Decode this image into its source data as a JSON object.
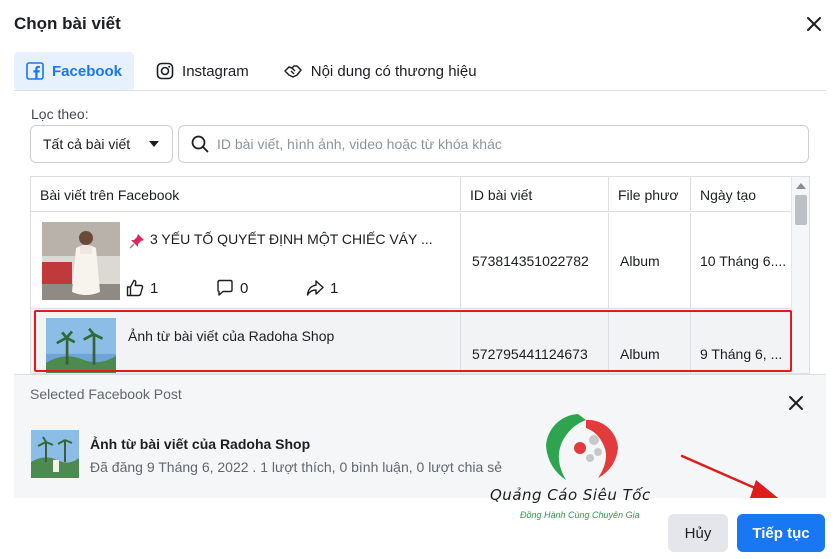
{
  "dialog": {
    "title": "Chọn bài viết"
  },
  "tabs": [
    {
      "label": "Facebook",
      "icon": "facebook-icon",
      "active": true
    },
    {
      "label": "Instagram",
      "icon": "instagram-icon",
      "active": false
    },
    {
      "label": "Nội dung có thương hiệu",
      "icon": "handshake-icon",
      "active": false
    }
  ],
  "filter": {
    "label": "Lọc theo:",
    "select_value": "Tất cả bài viết",
    "search_placeholder": "ID bài viết, hình ảnh, video hoặc từ khóa khác"
  },
  "table": {
    "headers": [
      "Bài viết trên Facebook",
      "ID bài viết",
      "File phươ",
      "Ngày tạo"
    ],
    "rows": [
      {
        "title": "3 YẾU TỐ QUYẾT ĐỊNH MỘT CHIẾC VÁY ...",
        "likes": "1",
        "comments": "0",
        "shares": "1",
        "post_id": "573814351022782",
        "type": "Album",
        "date": "10 Tháng 6...."
      },
      {
        "title": "Ảnh từ bài viết của Radoha Shop",
        "post_id": "572795441124673",
        "type": "Album",
        "date": "9 Tháng 6, ..."
      }
    ]
  },
  "selected": {
    "label": "Selected Facebook Post",
    "title": "Ảnh từ bài viết của Radoha Shop",
    "meta": "Đã đăng 9 Tháng 6, 2022 . 1 lượt thích, 0 bình luận, 0 lượt chia sẻ"
  },
  "watermark": {
    "brand": "Quảng Cáo Siêu Tốc",
    "tagline": "Đồng Hành Cùng Chuyên Gia"
  },
  "buttons": {
    "cancel": "Hủy",
    "next": "Tiếp tục"
  },
  "colors": {
    "accent": "#1877f2",
    "highlight": "#e01b1b",
    "tab_active_bg": "#e7f0fd"
  }
}
